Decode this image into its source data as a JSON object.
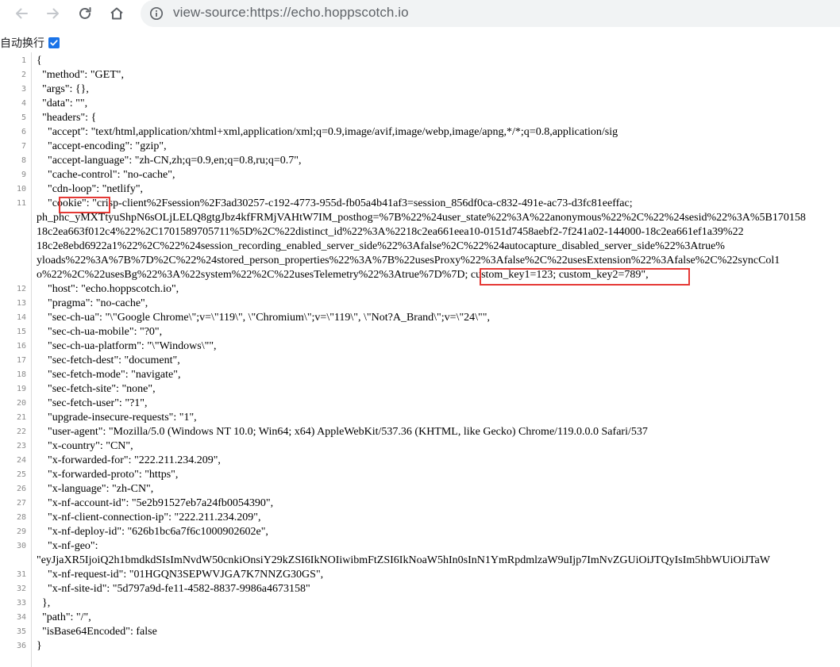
{
  "browser": {
    "url": "view-source:https://echo.hoppscotch.io",
    "icons": {
      "back": "arrow-left-icon",
      "forward": "arrow-right-icon",
      "reload": "reload-icon",
      "home": "home-icon",
      "site_info": "info-icon"
    }
  },
  "wrap_toggle": {
    "label": "自动换行",
    "checked": true
  },
  "accent_color": "#1a73e8",
  "highlight_color": "#e53935",
  "source": {
    "lines": [
      {
        "num": "1",
        "text": "{"
      },
      {
        "num": "2",
        "text": "  \"method\": \"GET\","
      },
      {
        "num": "3",
        "text": "  \"args\": {},"
      },
      {
        "num": "4",
        "text": "  \"data\": \"\","
      },
      {
        "num": "5",
        "text": "  \"headers\": {"
      },
      {
        "num": "6",
        "text": "    \"accept\": \"text/html,application/xhtml+xml,application/xml;q=0.9,image/avif,image/webp,image/apng,*/*;q=0.8,application/sig"
      },
      {
        "num": "7",
        "text": "    \"accept-encoding\": \"gzip\","
      },
      {
        "num": "8",
        "text": "    \"accept-language\": \"zh-CN,zh;q=0.9,en;q=0.8,ru;q=0.7\","
      },
      {
        "num": "9",
        "text": "    \"cache-control\": \"no-cache\","
      },
      {
        "num": "10",
        "text": "    \"cdn-loop\": \"netlify\","
      },
      {
        "num": "11",
        "text": "    \"cookie\": \"crisp-client%2Fsession%2F3ad30257-c192-4773-955d-fb05a4b41af3=session_856df0ca-c832-491e-ac73-d3fc81eeffac;"
      },
      {
        "num": "",
        "text": "ph_phc_yMXTtyuShpN6sOLjLELQ8gtgJbz4kfFRMjVAHtW7IM_posthog=%7B%22%24user_state%22%3A%22anonymous%22%2C%22%24sesid%22%3A%5B170158"
      },
      {
        "num": "",
        "text": "18c2ea663f012c4%22%2C1701589705711%5D%2C%22distinct_id%22%3A%2218c2ea661eea10-0151d7458aebf2-7f241a02-144000-18c2ea661ef1a39%22"
      },
      {
        "num": "",
        "text": "18c2e8ebd6922a1%22%2C%22%24session_recording_enabled_server_side%22%3Afalse%2C%22%24autocapture_disabled_server_side%22%3Atrue%"
      },
      {
        "num": "",
        "text": "yloads%22%3A%7B%7D%2C%22%24stored_person_properties%22%3A%7B%22usesProxy%22%3Afalse%2C%22usesExtension%22%3Afalse%2C%22syncCol1"
      },
      {
        "num": "",
        "text": "o%22%2C%22usesBg%22%3A%22system%22%2C%22usesTelemetry%22%3Atrue%7D%7D; custom_key1=123; custom_key2=789\","
      },
      {
        "num": "12",
        "text": "    \"host\": \"echo.hoppscotch.io\","
      },
      {
        "num": "13",
        "text": "    \"pragma\": \"no-cache\","
      },
      {
        "num": "14",
        "text": "    \"sec-ch-ua\": \"\\\"Google Chrome\\\";v=\\\"119\\\", \\\"Chromium\\\";v=\\\"119\\\", \\\"Not?A_Brand\\\";v=\\\"24\\\"\","
      },
      {
        "num": "15",
        "text": "    \"sec-ch-ua-mobile\": \"?0\","
      },
      {
        "num": "16",
        "text": "    \"sec-ch-ua-platform\": \"\\\"Windows\\\"\","
      },
      {
        "num": "17",
        "text": "    \"sec-fetch-dest\": \"document\","
      },
      {
        "num": "18",
        "text": "    \"sec-fetch-mode\": \"navigate\","
      },
      {
        "num": "19",
        "text": "    \"sec-fetch-site\": \"none\","
      },
      {
        "num": "20",
        "text": "    \"sec-fetch-user\": \"?1\","
      },
      {
        "num": "21",
        "text": "    \"upgrade-insecure-requests\": \"1\","
      },
      {
        "num": "22",
        "text": "    \"user-agent\": \"Mozilla/5.0 (Windows NT 10.0; Win64; x64) AppleWebKit/537.36 (KHTML, like Gecko) Chrome/119.0.0.0 Safari/537"
      },
      {
        "num": "23",
        "text": "    \"x-country\": \"CN\","
      },
      {
        "num": "24",
        "text": "    \"x-forwarded-for\": \"222.211.234.209\","
      },
      {
        "num": "25",
        "text": "    \"x-forwarded-proto\": \"https\","
      },
      {
        "num": "26",
        "text": "    \"x-language\": \"zh-CN\","
      },
      {
        "num": "27",
        "text": "    \"x-nf-account-id\": \"5e2b91527eb7a24fb0054390\","
      },
      {
        "num": "28",
        "text": "    \"x-nf-client-connection-ip\": \"222.211.234.209\","
      },
      {
        "num": "29",
        "text": "    \"x-nf-deploy-id\": \"626b1bc6a7f6c1000902602e\","
      },
      {
        "num": "30",
        "text": "    \"x-nf-geo\":"
      },
      {
        "num": "",
        "text": "\"eyJjaXR5IjoiQ2h1bmdkdSIsImNvdW50cnkiOnsiY29kZSI6IkNOIiwibmFtZSI6IkNoaW5hIn0sInN1YmRpdmlzaW9uIjp7ImNvZGUiOiJTQyIsIm5hbWUiOiJTaW"
      },
      {
        "num": "31",
        "text": "    \"x-nf-request-id\": \"01HGQN3SEPWVJGA7K7NNZG30GS\","
      },
      {
        "num": "32",
        "text": "    \"x-nf-site-id\": \"5d797a9d-fe11-4582-8837-9986a4673158\""
      },
      {
        "num": "33",
        "text": "  },"
      },
      {
        "num": "34",
        "text": "  \"path\": \"/\","
      },
      {
        "num": "35",
        "text": "  \"isBase64Encoded\": false"
      },
      {
        "num": "36",
        "text": "}"
      }
    ]
  }
}
